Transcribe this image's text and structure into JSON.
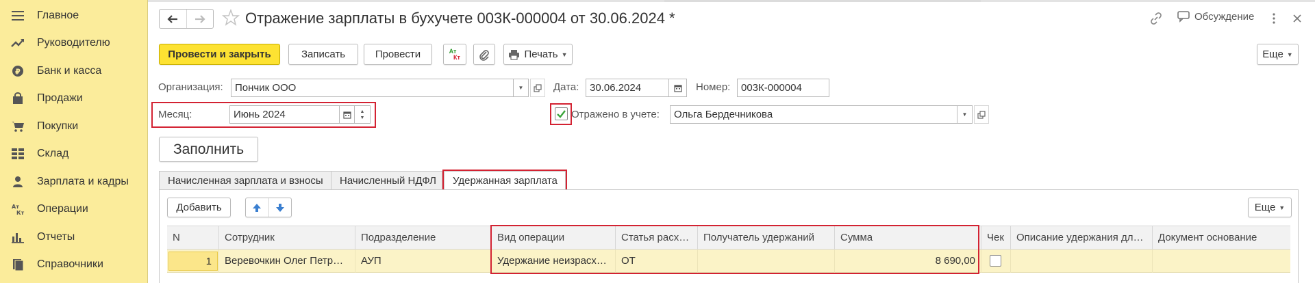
{
  "sidebar": {
    "items": [
      {
        "label": "Главное",
        "icon": "menu-icon"
      },
      {
        "label": "Руководителю",
        "icon": "trend-icon"
      },
      {
        "label": "Банк и касса",
        "icon": "ruble-coin-icon"
      },
      {
        "label": "Продажи",
        "icon": "shopping-bag-icon"
      },
      {
        "label": "Покупки",
        "icon": "cart-icon"
      },
      {
        "label": "Склад",
        "icon": "warehouse-grid-icon"
      },
      {
        "label": "Зарплата и кадры",
        "icon": "person-icon"
      },
      {
        "label": "Операции",
        "icon": "debit-credit-icon"
      },
      {
        "label": "Отчеты",
        "icon": "bar-chart-icon"
      },
      {
        "label": "Справочники",
        "icon": "books-icon"
      }
    ]
  },
  "header": {
    "title": "Отражение зарплаты в бухучете 003К-000004 от 30.06.2024 *",
    "discussion_label": "Обсуждение"
  },
  "toolbar": {
    "post_close_label": "Провести и закрыть",
    "save_label": "Записать",
    "post_label": "Провести",
    "dtkt_top": "Ат",
    "dtkt_bottom": "Кт",
    "print_label": "Печать",
    "more_label": "Еще"
  },
  "form": {
    "org_label": "Организация:",
    "org_value": "Пончик ООО",
    "date_label": "Дата:",
    "date_value": "30.06.2024",
    "number_label": "Номер:",
    "number_value": "003К-000004",
    "month_label": "Месяц:",
    "month_value": "Июнь 2024",
    "reflected_label": "Отражено в учете:",
    "reflected_checked": true,
    "reflected_user": "Ольга Бердечникова",
    "fill_label": "Заполнить"
  },
  "tabs": [
    {
      "label": "Начисленная зарплата и взносы",
      "active": false
    },
    {
      "label": "Начисленный НДФЛ",
      "active": false
    },
    {
      "label": "Удержанная зарплата",
      "active": true
    }
  ],
  "table_toolbar": {
    "add_label": "Добавить",
    "more_label": "Еще"
  },
  "table": {
    "columns": [
      "N",
      "Сотрудник",
      "Подразделение",
      "Вид операции",
      "Статья расх…",
      "Получатель удержаний",
      "Сумма",
      "Чек",
      "Описание удержания дл…",
      "Документ основание"
    ],
    "rows": [
      {
        "n": "1",
        "employee": "Веревочкин Олег Петр…",
        "department": "АУП",
        "operation": "Удержание неизрасх…",
        "expense_item": "ОТ",
        "recipient": "",
        "amount": "8 690,00",
        "check": false,
        "description": "",
        "base_document": ""
      }
    ]
  },
  "colors": {
    "sidebar_bg": "#fbec9b",
    "primary_button": "#fde232",
    "highlight": "#d32232",
    "selected_row": "#fbf3c7",
    "check_green": "#3aa53a"
  }
}
